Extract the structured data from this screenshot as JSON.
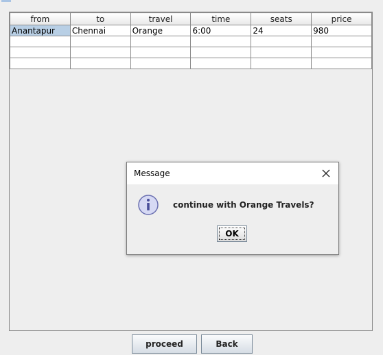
{
  "table": {
    "columns": [
      "from",
      "to",
      "travel",
      "time",
      "seats",
      "price"
    ],
    "rows": [
      [
        "Anantapur",
        "Chennai",
        "Orange",
        "6:00",
        "24",
        "980"
      ],
      [
        "",
        "",
        "",
        "",
        "",
        ""
      ],
      [
        "",
        "",
        "",
        "",
        "",
        ""
      ],
      [
        "",
        "",
        "",
        "",
        "",
        ""
      ]
    ]
  },
  "dialog": {
    "title": "Message",
    "close_icon": "close-icon",
    "info_icon": "information-icon",
    "message": "continue with Orange Travels?",
    "ok_label": "OK"
  },
  "buttons": {
    "proceed_label": "proceed",
    "back_label": "Back"
  },
  "colors": {
    "selected_cell": "#b8cfe5",
    "info_icon_fill": "#d6d9f4",
    "info_icon_stroke": "#6a6fb0"
  }
}
